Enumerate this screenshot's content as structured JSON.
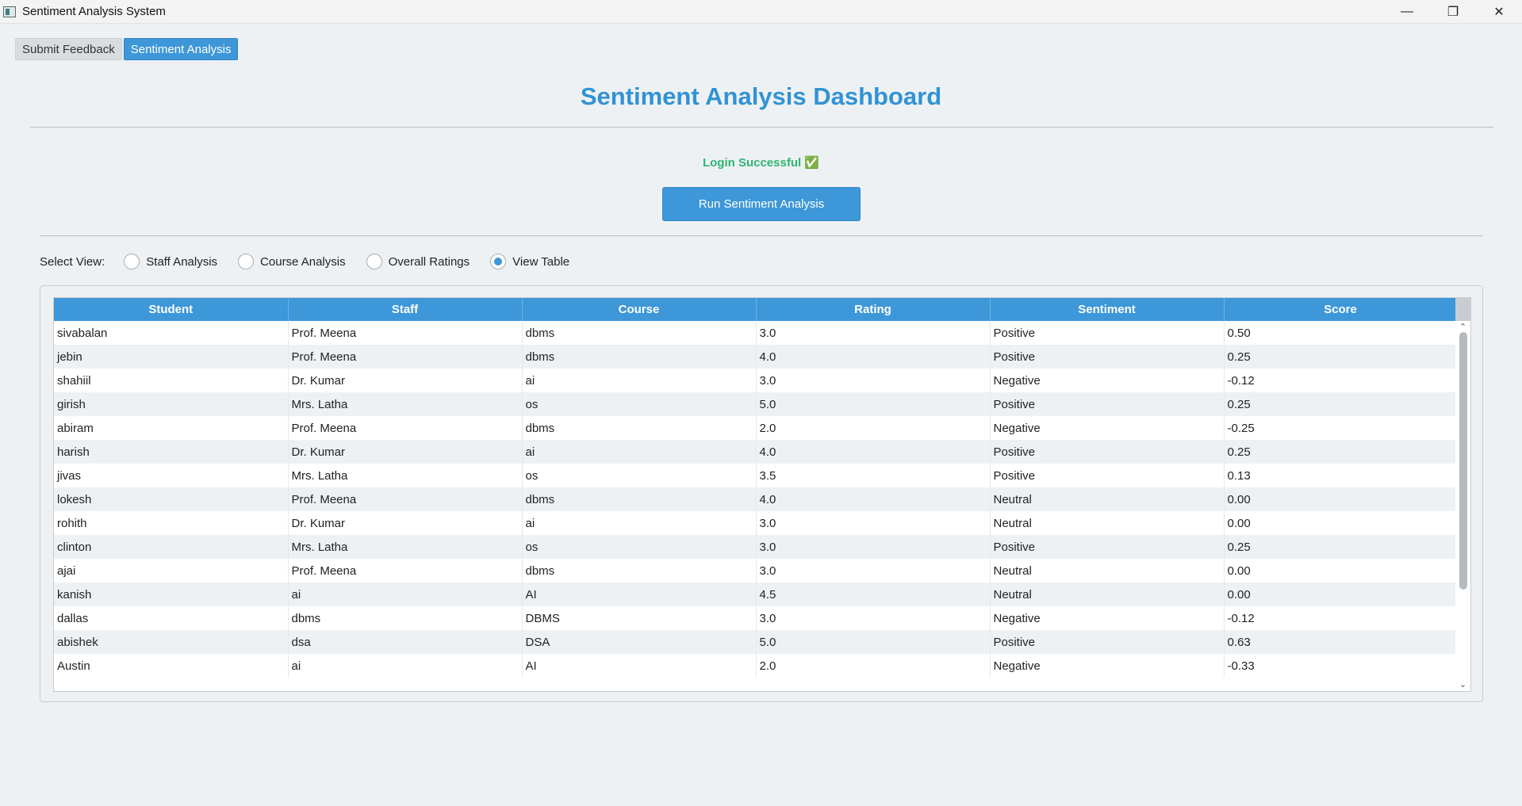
{
  "window": {
    "title": "Sentiment Analysis System",
    "controls": {
      "minimize": "—",
      "restore": "❐",
      "close": "✕"
    }
  },
  "tabs": [
    {
      "label": "Submit Feedback",
      "active": false
    },
    {
      "label": "Sentiment Analysis",
      "active": true
    }
  ],
  "dashboard": {
    "title": "Sentiment Analysis Dashboard",
    "login_message": "Login Successful ✅",
    "run_button": "Run Sentiment Analysis"
  },
  "view_selector": {
    "label": "Select View:",
    "options": [
      "Staff Analysis",
      "Course Analysis",
      "Overall Ratings",
      "View Table"
    ],
    "selected": "View Table"
  },
  "table": {
    "columns": [
      "Student",
      "Staff",
      "Course",
      "Rating",
      "Sentiment",
      "Score"
    ],
    "rows": [
      [
        "sivabalan",
        "Prof. Meena",
        "dbms",
        "3.0",
        "Positive",
        "0.50"
      ],
      [
        "jebin",
        "Prof. Meena",
        "dbms",
        "4.0",
        "Positive",
        "0.25"
      ],
      [
        "shahiil",
        "Dr. Kumar",
        "ai",
        "3.0",
        "Negative",
        "-0.12"
      ],
      [
        "girish",
        "Mrs. Latha",
        "os",
        "5.0",
        "Positive",
        "0.25"
      ],
      [
        "abiram",
        "Prof. Meena",
        "dbms",
        "2.0",
        "Negative",
        "-0.25"
      ],
      [
        "harish",
        "Dr. Kumar",
        "ai",
        "4.0",
        "Positive",
        "0.25"
      ],
      [
        "jivas",
        "Mrs. Latha",
        "os",
        "3.5",
        "Positive",
        "0.13"
      ],
      [
        "lokesh",
        "Prof. Meena",
        "dbms",
        "4.0",
        "Neutral",
        "0.00"
      ],
      [
        "rohith",
        "Dr. Kumar",
        "ai",
        "3.0",
        "Neutral",
        "0.00"
      ],
      [
        "clinton",
        "Mrs. Latha",
        "os",
        "3.0",
        "Positive",
        "0.25"
      ],
      [
        "ajai",
        "Prof. Meena",
        "dbms",
        "3.0",
        "Neutral",
        "0.00"
      ],
      [
        "kanish",
        "ai",
        "AI",
        "4.5",
        "Neutral",
        "0.00"
      ],
      [
        "dallas",
        "dbms",
        "DBMS",
        "3.0",
        "Negative",
        "-0.12"
      ],
      [
        "abishek",
        "dsa",
        "DSA",
        "5.0",
        "Positive",
        "0.63"
      ],
      [
        "Austin",
        "ai",
        "AI",
        "2.0",
        "Negative",
        "-0.33"
      ]
    ]
  },
  "colors": {
    "accent": "#3d97d8",
    "title": "#3193d4",
    "success": "#2bb673",
    "background": "#eef1f3"
  }
}
